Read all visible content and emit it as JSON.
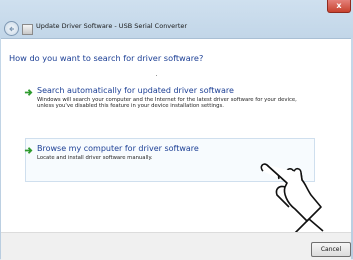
{
  "window": {
    "title": "Update Driver Software - USB Serial Converter",
    "close_glyph": "x"
  },
  "main": {
    "heading": "How do you want to search for driver software?",
    "options": [
      {
        "title": "Search automatically for updated driver software",
        "description": "Windows will search your computer and the Internet for the latest driver software for your device, unless you've disabled this feature in your device installation settings.",
        "icon": "green-arrow-icon"
      },
      {
        "title": "Browse my computer for driver software",
        "description": "Locate and install driver software manually.",
        "icon": "green-arrow-icon"
      }
    ]
  },
  "footer": {
    "cancel_label": "Cancel"
  },
  "icons": {
    "back": "back-arrow-icon",
    "hand": "pointing-hand-icon"
  },
  "colors": {
    "link_blue": "#1c3f95",
    "arrow_green": "#2e9b2e",
    "close_red": "#c7422e"
  }
}
